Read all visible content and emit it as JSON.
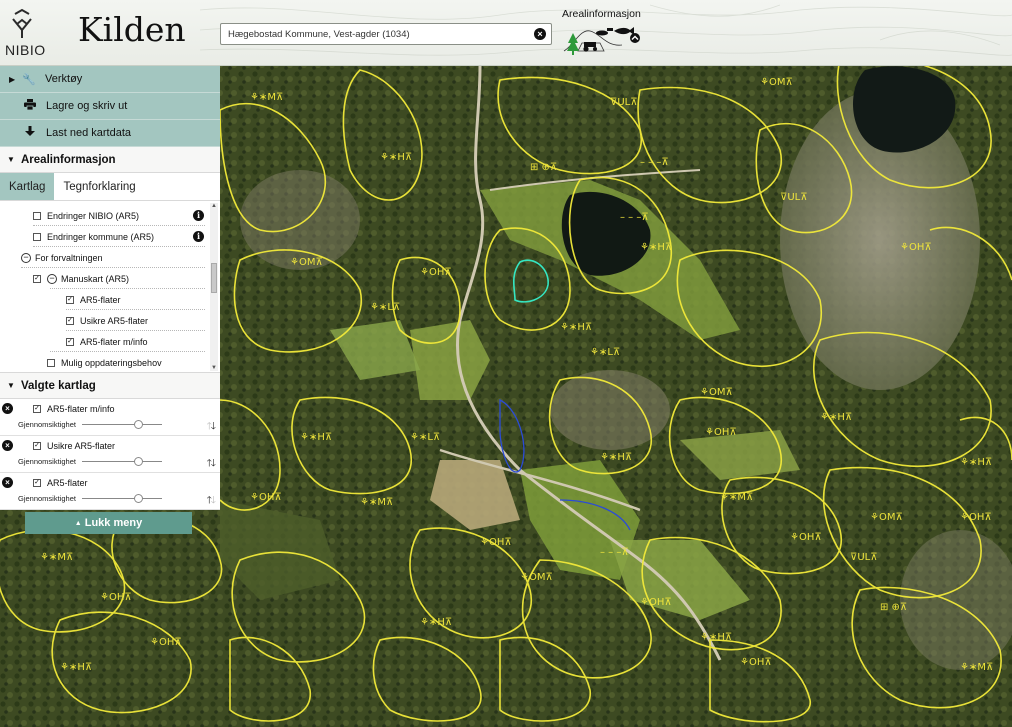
{
  "header": {
    "logo_text": "NIBIO",
    "app_title": "Kilden",
    "search_value": "Hægebostad Kommune, Vest-agder (1034)",
    "areal_title": "Arealinformasjon"
  },
  "sidebar": {
    "tools": [
      {
        "label": "Verktøy",
        "icon": "wrench-icon"
      },
      {
        "label": "Lagre og skriv ut",
        "icon": "print-icon"
      },
      {
        "label": "Last ned kartdata",
        "icon": "download-icon"
      }
    ],
    "areal_section": "Arealinformasjon",
    "tabs": [
      {
        "label": "Kartlag",
        "active": true
      },
      {
        "label": "Tegnforklaring",
        "active": false
      }
    ],
    "tree": [
      {
        "label": "Endringer NIBIO (AR5)",
        "checked": false,
        "info": true
      },
      {
        "label": "Endringer kommune (AR5)",
        "checked": false,
        "info": true
      },
      {
        "label": "For forvaltningen",
        "group": true
      },
      {
        "label": "Manuskart (AR5)",
        "checked": true,
        "group": true
      },
      {
        "label": "AR5-flater",
        "checked": true
      },
      {
        "label": "Usikre AR5-flater",
        "checked": true
      },
      {
        "label": "AR5-flater m/info",
        "checked": true
      },
      {
        "label": "Mulig oppdateringsbehov",
        "checked": false
      }
    ],
    "selected_section": "Valgte kartlag",
    "selected_layers": [
      {
        "label": "AR5-flater m/info",
        "opacity_label": "Gjennomsiktighet",
        "opacity": 0.7
      },
      {
        "label": "Usikre AR5-flater",
        "opacity_label": "Gjennomsiktighet",
        "opacity": 0.7
      },
      {
        "label": "AR5-flater",
        "opacity_label": "Gjennomsiktighet",
        "opacity": 0.7
      }
    ],
    "close_menu": "Lukk meny"
  },
  "colors": {
    "panel_teal": "#a3c6c0",
    "close_button": "#5f9b8e",
    "map_lines": "#f2ea3a"
  },
  "map_labels": [
    "⚘∗M⊼",
    "⚘∗H⊼",
    "⚘OH⊼",
    "⚘OM⊼",
    "⚘∗L⊼",
    "⊽UL⊼",
    "⊞ ⊕⊼",
    "– – –⊼",
    "⚘OM⊼",
    "⚘∗H⊼",
    "⚘OM⊼",
    "⚘∗H⊼",
    "⚘∗L⊼",
    "⚘OH⊼",
    "⚘∗H⊼",
    "⊽UL⊼",
    "⚘OH⊼",
    "⚘∗H⊼",
    "⚘OM⊼",
    "⚘∗M⊼",
    "– – –⊼",
    "⚘OH⊼",
    "⚘∗H⊼",
    "⚘OH⊼",
    "⊞ ⊕⊼",
    "⚘∗M⊼",
    "⚘OH⊼",
    "⊽UL⊼",
    "⚘∗H⊼",
    "⚘OM⊼",
    "⚘OH⊼",
    "⚘∗H⊼",
    "⚘∗M⊼",
    "⚘OH⊼",
    "⚘∗M⊼",
    "⚘OH⊼",
    "⚘∗H⊼",
    "⚘∗L⊼",
    "⚘OH⊼",
    "⚘OH⊼",
    "– – –⊼",
    "⚘∗H⊼"
  ]
}
